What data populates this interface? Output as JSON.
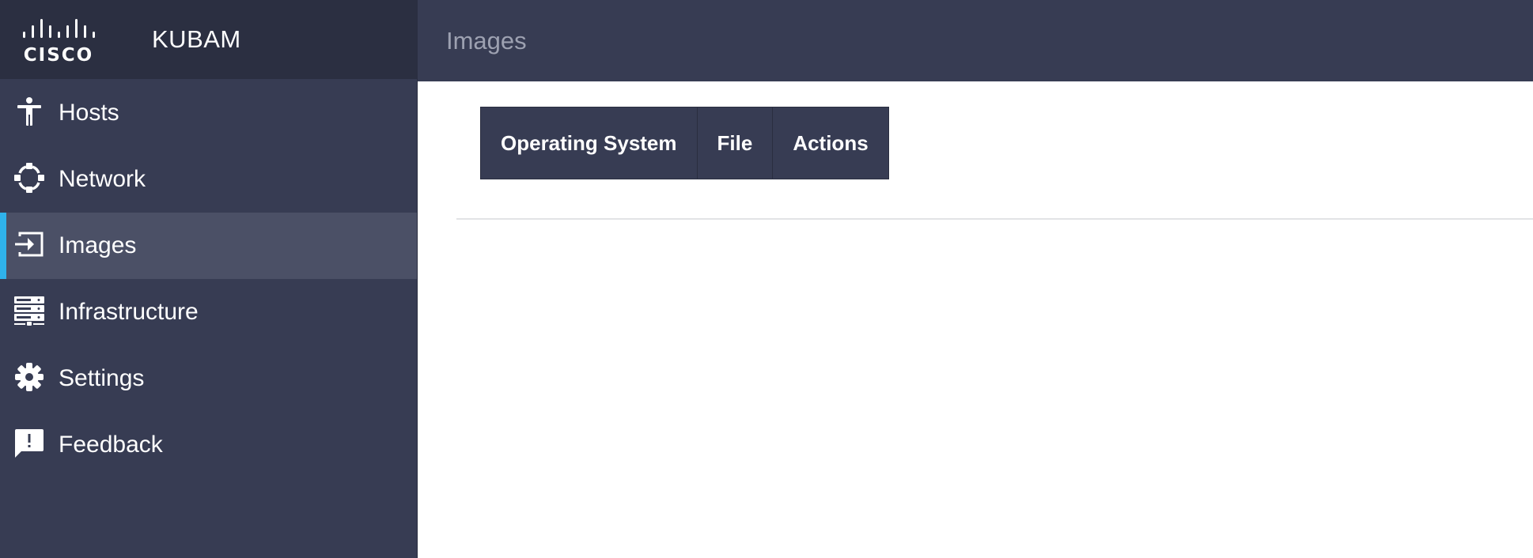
{
  "brand": {
    "logo_text": "CISCO",
    "app_name": "KUBAM"
  },
  "sidebar": {
    "items": [
      {
        "label": "Hosts",
        "icon": "person-icon",
        "active": false
      },
      {
        "label": "Network",
        "icon": "network-icon",
        "active": false
      },
      {
        "label": "Images",
        "icon": "image-import-icon",
        "active": true
      },
      {
        "label": "Infrastructure",
        "icon": "server-rack-icon",
        "active": false
      },
      {
        "label": "Settings",
        "icon": "gear-icon",
        "active": false
      },
      {
        "label": "Feedback",
        "icon": "feedback-icon",
        "active": false
      }
    ]
  },
  "header": {
    "title": "Images"
  },
  "table": {
    "columns": [
      "Operating System",
      "File",
      "Actions"
    ],
    "rows": []
  },
  "colors": {
    "sidebar_bg": "#373c53",
    "brand_bg": "#2b2f41",
    "active_item_bg": "#4b5066",
    "accent": "#2fb2ea",
    "title_muted": "#9da1b1"
  }
}
